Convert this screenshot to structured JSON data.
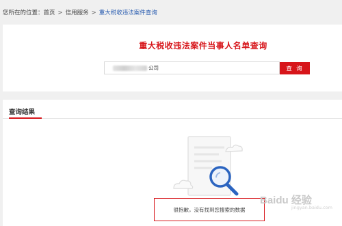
{
  "breadcrumb": {
    "prefix": "您所在的位置：",
    "items": [
      "首页",
      "信用服务",
      "重大税收违法案件查询"
    ],
    "separator": ">"
  },
  "search": {
    "title": "重大税收违法案件当事人名单查询",
    "value_visible": "公司",
    "button_label": "查 询"
  },
  "results": {
    "heading": "查询结果",
    "empty_message": "很抱歉，没有找到您搜索的数据"
  },
  "watermark": {
    "text": "Baidu 经验",
    "sub": "jingyan.baidu.com"
  },
  "colors": {
    "accent": "#d7151a",
    "link": "#2a5db0"
  }
}
